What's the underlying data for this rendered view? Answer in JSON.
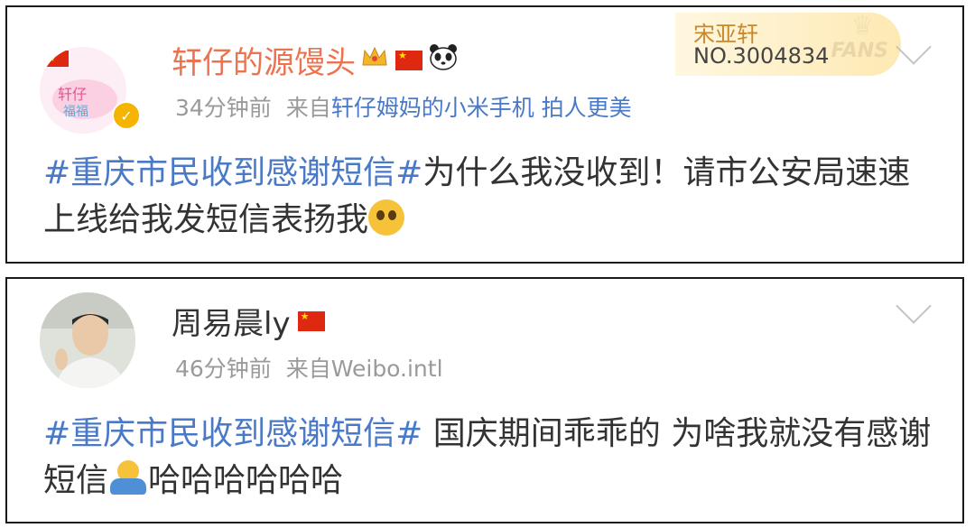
{
  "post1": {
    "username": "轩仔的源馒头",
    "time": "34分钟前",
    "source_prefix": "来自",
    "source": "轩仔姆妈的小米手机 拍人更美",
    "hashtag": "#重庆市民收到感谢短信#",
    "text": "为什么我没收到！请市公安局速速上线给我发短信表扬我",
    "fans_badge": {
      "name": "宋亚轩",
      "number": "NO.3004834",
      "label": "FANS"
    },
    "icons": [
      "crown-icon",
      "china-flag-icon",
      "panda-icon",
      "verified-badge-icon",
      "pleading-face-emoji",
      "chevron-down-icon"
    ]
  },
  "post2": {
    "username": "周易晨ly",
    "time": "46分钟前",
    "source_prefix": "来自",
    "source": "Weibo.intl",
    "hashtag": "#重庆市民收到感谢短信#",
    "text_before_emoji": " 国庆期间乖乖的 为啥我就没有感谢短信",
    "text_after_emoji": "哈哈哈哈哈哈",
    "icons": [
      "china-flag-icon",
      "shrug-emoji",
      "chevron-down-icon"
    ]
  },
  "colors": {
    "hashtag": "#4a79c7",
    "vip_username": "#eb7350",
    "meta": "#9a9a9a",
    "text": "#333333"
  }
}
